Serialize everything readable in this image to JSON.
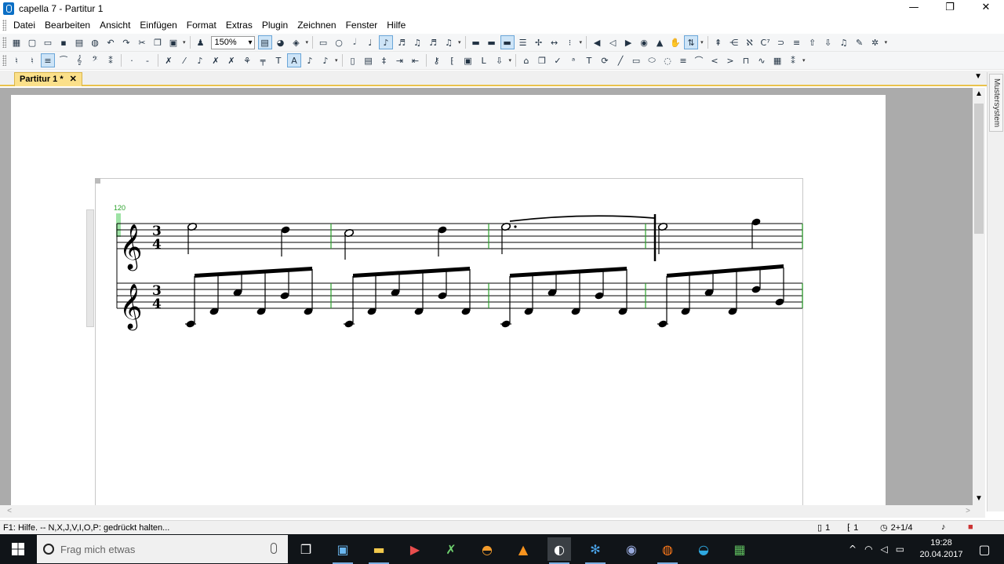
{
  "window": {
    "title": "capella 7 - Partitur 1",
    "controls": {
      "minimize": "—",
      "maximize": "❐",
      "close": "✕"
    }
  },
  "menu": [
    "Datei",
    "Bearbeiten",
    "Ansicht",
    "Einfügen",
    "Format",
    "Extras",
    "Plugin",
    "Zeichnen",
    "Fenster",
    "Hilfe"
  ],
  "toolbar": {
    "zoom": "150%",
    "row1_icons": [
      "new-score-icon",
      "new-icon",
      "open-icon",
      "save-icon",
      "print-icon",
      "web-icon",
      "undo-icon",
      "redo-icon",
      "cut-icon",
      "copy-icon",
      "paste-icon",
      "soloist-icon",
      "zoom-select",
      "page-view-icon",
      "color-icon",
      "paint-icon",
      "rect-icon",
      "whole-note-icon",
      "half-note-icon",
      "quarter-note-icon",
      "eighth-note-icon",
      "sixteenth-note-icon",
      "thirtysecond-note-icon",
      "sixtyfourth-note-icon",
      "system-icon",
      "staff-icon",
      "voice-icon",
      "layout-icon",
      "beam-icon",
      "stretch-icon",
      "speaker-icon",
      "speaker-off-icon",
      "play-icon",
      "record-icon",
      "metronome-icon",
      "cursor-icon",
      "transpose-icon",
      "pitch-icon",
      "chord-icon",
      "lyrics-icon",
      "arrow-up-icon",
      "arrow-down-icon",
      "notes-icon",
      "pen-icon",
      "tools-icon"
    ],
    "row2_icons": [
      "accidental-icon",
      "barline-icon",
      "staff-insert-icon",
      "treble-clef-icon",
      "bass-clef-icon",
      "time-sig-icon",
      "dot-icon",
      "dash-icon",
      "cross-icon",
      "slash-icon",
      "ornament-icon",
      "dynamics-icon",
      "beam-group-icon",
      "tuplet-icon",
      "text-style-icon",
      "lyric-icon",
      "book-icon",
      "layout-page-icon",
      "spacing-icon",
      "indent-icon",
      "key-icon",
      "bracket-icon",
      "box-icon",
      "text-icon",
      "arrow-icon",
      "library-icon",
      "copy-sheet-icon",
      "check-icon",
      "spell-icon",
      "text-tool-icon",
      "circle-arrow-icon",
      "line-icon",
      "rectangle-icon",
      "ellipse-icon",
      "shape-icon",
      "lines-icon",
      "crescendo-icon",
      "diminuendo-icon",
      "hairpin-icon",
      "bracket-line-icon",
      "trill-icon",
      "grid-icon",
      "more-icon"
    ]
  },
  "document_tab": {
    "label": "Partitur 1 *",
    "close": "✕"
  },
  "score": {
    "tempo": "120",
    "upper_staff": {
      "clef": "treble",
      "time_signature": [
        "3",
        "4"
      ]
    },
    "lower_staff": {
      "clef": "treble",
      "time_signature": [
        "3",
        "4"
      ]
    }
  },
  "side_panel": {
    "label": "Mustersystem"
  },
  "status": {
    "help": "F1: Hilfe. -- N,X,J,V,I,O,P: gedrückt halten...",
    "page": "1",
    "system": "1",
    "position": "2+1/4"
  },
  "taskbar": {
    "search_placeholder": "Frag mich etwas",
    "time": "19:28",
    "date": "20.04.2017"
  }
}
